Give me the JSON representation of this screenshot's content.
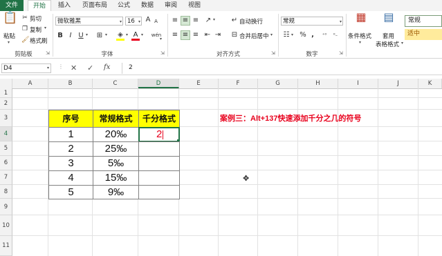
{
  "ribbon": {
    "tabs": [
      "文件",
      "开始",
      "插入",
      "页面布局",
      "公式",
      "数据",
      "审阅",
      "视图"
    ],
    "active_tab": "开始",
    "clipboard": {
      "paste": "粘贴",
      "cut": "剪切",
      "copy": "复制",
      "format_painter": "格式刷",
      "group_label": "剪贴板"
    },
    "font": {
      "name": "微软雅黑",
      "size": "16",
      "bold": "B",
      "italic": "I",
      "underline": "U",
      "grow": "A",
      "shrink": "A",
      "font_color_glyph": "A",
      "fill_glyph": "◈",
      "border_glyph": "⊞",
      "wen_glyph": "wén",
      "group_label": "字体"
    },
    "alignment": {
      "wrap_text": "自动换行",
      "merge_center": "合并后居中",
      "group_label": "对齐方式"
    },
    "number": {
      "format": "常规",
      "currency": "☷",
      "percent": "%",
      "comma": ",",
      "group_label": "数字"
    },
    "styles": {
      "conditional": "条件格式",
      "table_format_1": "套用",
      "table_format_2": "表格格式",
      "style_normal": "常规",
      "style_neutral": "适中"
    }
  },
  "formula_bar": {
    "name_box": "D4",
    "value": "2",
    "cancel_glyph": "✕",
    "enter_glyph": "✓",
    "fx": "fx"
  },
  "grid": {
    "columns": [
      "A",
      "B",
      "C",
      "D",
      "E",
      "F",
      "G",
      "H",
      "I",
      "J",
      "K"
    ],
    "rows": [
      "1",
      "2",
      "3",
      "4",
      "5",
      "6",
      "7",
      "8",
      "9",
      "10",
      "11"
    ],
    "selected_cell": "D4"
  },
  "table": {
    "headers": [
      "序号",
      "常规格式",
      "千分格式"
    ],
    "rows": [
      [
        "1",
        "20‰",
        "2"
      ],
      [
        "2",
        "25‰",
        ""
      ],
      [
        "3",
        "5‰",
        ""
      ],
      [
        "4",
        "15‰",
        ""
      ],
      [
        "5",
        "9‰",
        ""
      ]
    ]
  },
  "annotation": "案例三：Alt+137快速添加千分之几的符号",
  "colors": {
    "excel_green": "#217346",
    "header_fill": "#ffff00",
    "annotation_red": "#e8001c",
    "edit_red": "#e8001c"
  }
}
